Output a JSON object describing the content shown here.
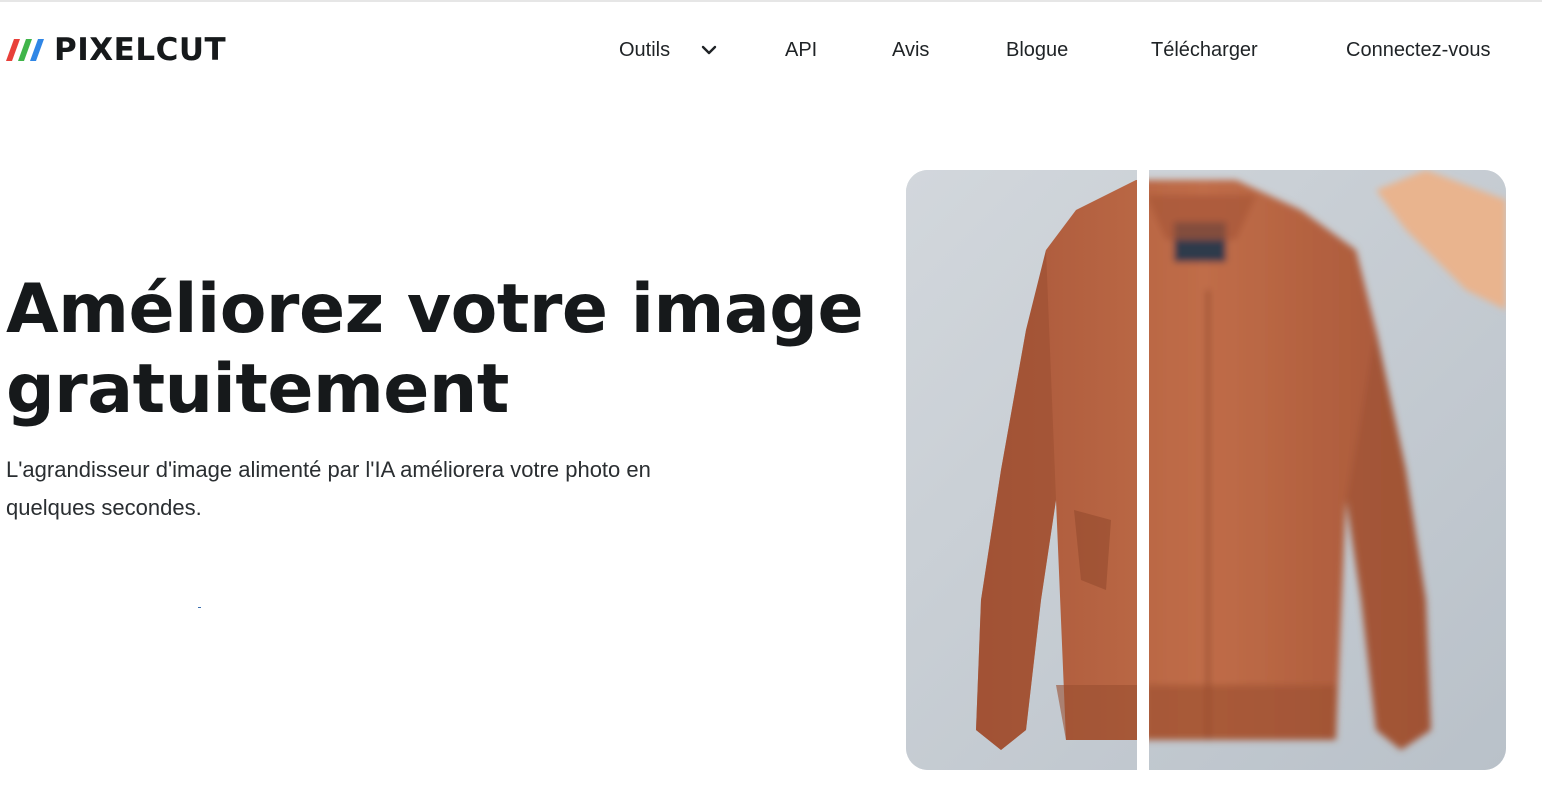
{
  "brand": {
    "name": "PIXELCUT",
    "stripe_colors": [
      "#e8403a",
      "#3fb54a",
      "#2f86e6"
    ]
  },
  "nav": {
    "tools": "Outils",
    "api": "API",
    "reviews": "Avis",
    "blog": "Blogue",
    "download": "Télécharger",
    "login": "Connectez-vous"
  },
  "hero": {
    "title_line1": "Améliorez votre image",
    "title_line2": "gratuitement",
    "subtitle_line1": "L'agrandisseur d'image alimenté par l'IA améliorera votre photo en",
    "subtitle_line2": "quelques secondes."
  },
  "compare": {
    "split_fraction": 0.385,
    "colors": {
      "background": "#c9cfd6",
      "jacket": "#b8633f",
      "jacket_shadow": "#9a4f31",
      "hand": "#e9b48e"
    }
  }
}
